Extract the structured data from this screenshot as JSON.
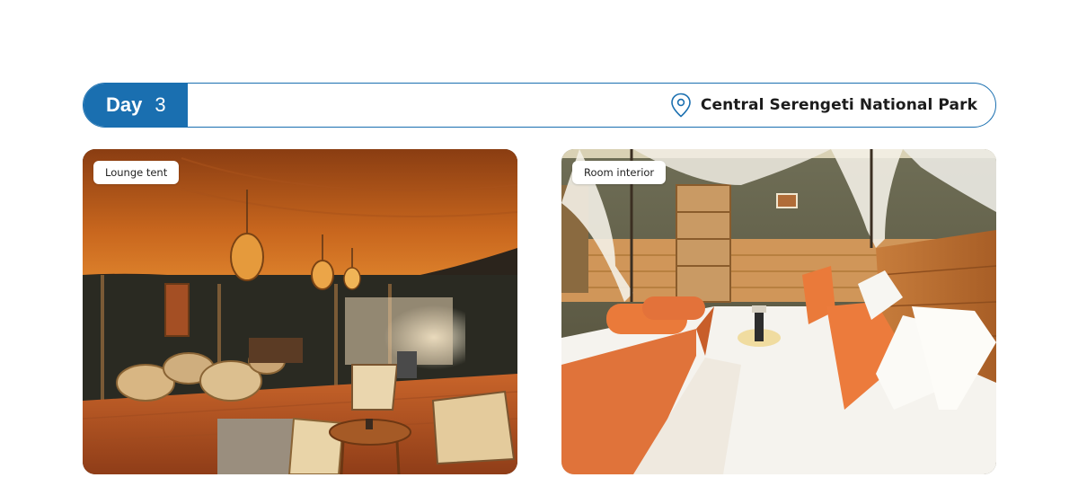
{
  "header": {
    "day_label": "Day",
    "day_number": "3",
    "location": "Central Serengeti National Park",
    "location_icon": "map-pin-icon",
    "accent_color": "#1a6fb0"
  },
  "photos": [
    {
      "caption": "Lounge tent"
    },
    {
      "caption": "Room interior"
    }
  ]
}
